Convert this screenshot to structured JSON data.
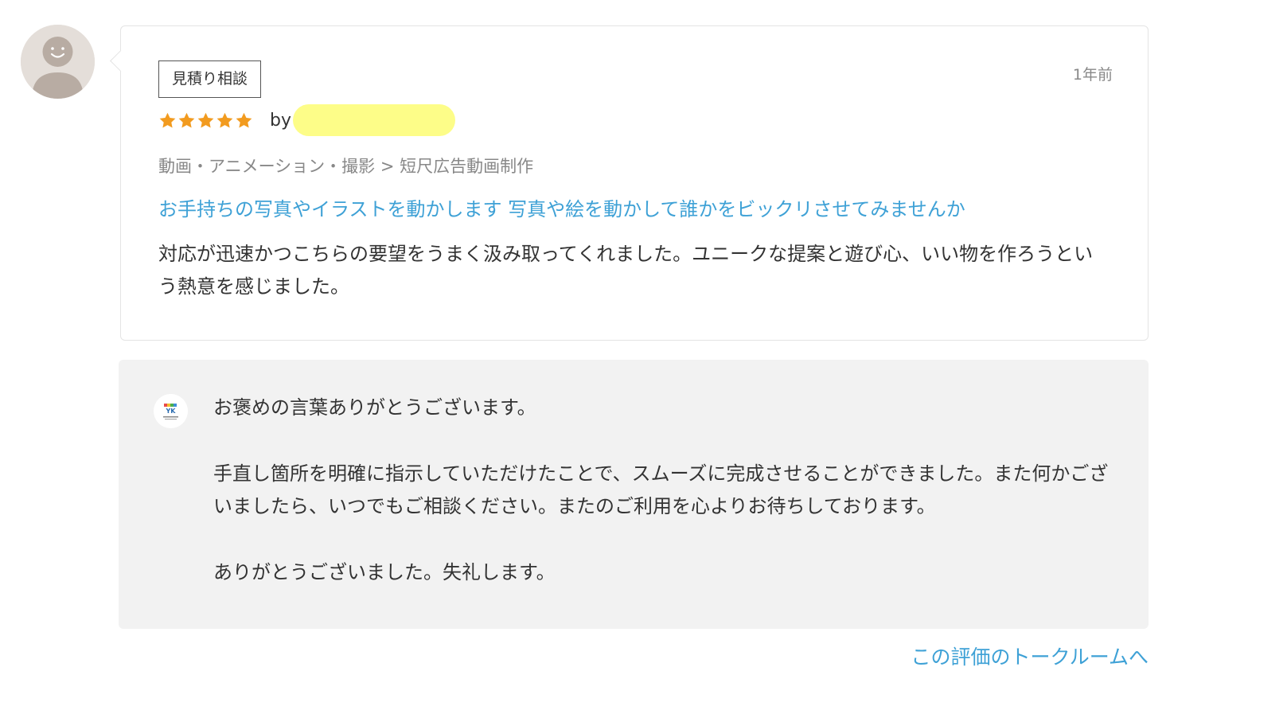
{
  "review": {
    "type_badge": "見積り相談",
    "time_ago": "1年前",
    "rating": 5,
    "rating_max": 5,
    "by_label": "by",
    "category_path": "動画・アニメーション・撮影 > 短尺広告動画制作",
    "service_title": "お手持ちの写真やイラストを動かします 写真や絵を動かして誰かをビックリさせてみませんか",
    "text": "対応が迅速かつこちらの要望をうまく汲み取ってくれました。ユニークな提案と遊び心、いい物を作ろうという熱意を感じました。"
  },
  "reply": {
    "paragraphs": [
      "お褒めの言葉ありがとうございます。",
      "手直し箇所を明確に指示していただけたことで、スムーズに完成させることができました。また何かございましたら、いつでもご相談ください。またのご利用を心よりお待ちしております。",
      "ありがとうございました。失礼します。"
    ]
  },
  "talkroom_link": "この評価のトークルームへ",
  "colors": {
    "accent_link": "#3ea1d6",
    "star": "#f29b1f",
    "reply_bg": "#f2f2f2",
    "name_mask": "#fdfd88"
  },
  "icons": {
    "reviewer_avatar": "default-user-avatar-icon",
    "star": "star-icon",
    "seller_avatar": "seller-logo-icon"
  }
}
